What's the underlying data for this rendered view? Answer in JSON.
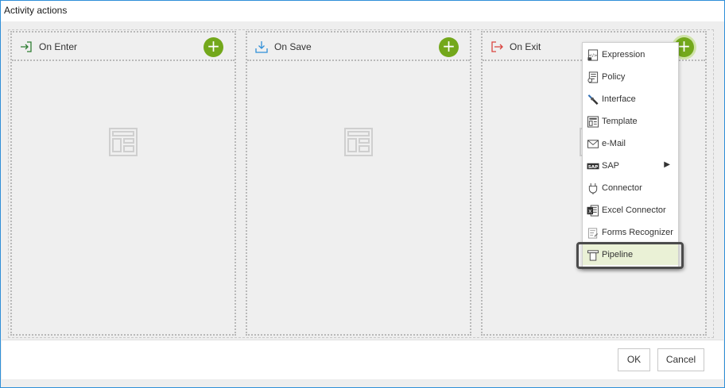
{
  "dialog": {
    "title": "Activity actions"
  },
  "panels": [
    {
      "title": "On Enter",
      "icon": "enter-icon"
    },
    {
      "title": "On Save",
      "icon": "download-icon"
    },
    {
      "title": "On Exit",
      "icon": "exit-icon"
    }
  ],
  "add_button": {
    "label": "+"
  },
  "menu": {
    "items": [
      {
        "label": "Expression",
        "icon": "expression-icon"
      },
      {
        "label": "Policy",
        "icon": "policy-icon"
      },
      {
        "label": "Interface",
        "icon": "interface-icon"
      },
      {
        "label": "Template",
        "icon": "template-icon"
      },
      {
        "label": "e-Mail",
        "icon": "email-icon"
      },
      {
        "label": "SAP",
        "icon": "sap-icon",
        "submenu_arrow": "▶"
      },
      {
        "label": "Connector",
        "icon": "connector-icon"
      },
      {
        "label": "Excel Connector",
        "icon": "excel-icon"
      },
      {
        "label": "Forms Recognizer",
        "icon": "forms-recognizer-icon"
      },
      {
        "label": "Pipeline",
        "icon": "pipeline-icon",
        "highlighted": true
      }
    ]
  },
  "footer": {
    "ok_label": "OK",
    "cancel_label": "Cancel"
  },
  "colors": {
    "accent_green": "#73a81b",
    "border_blue": "#2f8fd8",
    "exit_red": "#d9443f",
    "enter_green": "#2e7d32",
    "save_blue": "#2f8fd8"
  }
}
